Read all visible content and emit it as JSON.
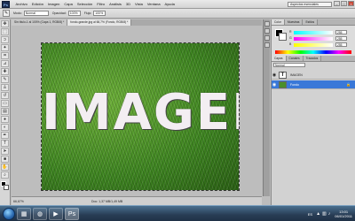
{
  "app": {
    "logo_text": "Ps"
  },
  "menu": [
    "Archivo",
    "Edición",
    "Imagen",
    "Capa",
    "Selección",
    "Filtro",
    "Análisis",
    "3D",
    "Vista",
    "Ventana",
    "Ayuda"
  ],
  "workspace": {
    "label": "Aspectos esenciales"
  },
  "options_bar": {
    "mode_label": "Modo:",
    "mode_value": "Normal",
    "opacity_label": "Opacidad:",
    "opacity_value": "100%",
    "flow_label": "Flujo:",
    "flow_value": "100%"
  },
  "tabs": [
    {
      "label": "Sin título-1 al 100% (Capa 1, RGB/8) *",
      "active": false
    },
    {
      "label": "fondo-grande.jpg al 66,7% (Fondo, RGB/8) *",
      "active": true
    }
  ],
  "canvas": {
    "text": "IMAGEN"
  },
  "status": {
    "zoom": "66,67%",
    "doc_info": "Doc: 1,37 MB/1,49 MB"
  },
  "color_panel": {
    "tabs": [
      "Color",
      "Muestras",
      "Estilos"
    ],
    "sliders": [
      {
        "label": "R",
        "value": "255"
      },
      {
        "label": "G",
        "value": "255"
      },
      {
        "label": "B",
        "value": "255"
      }
    ]
  },
  "layers_panel": {
    "tabs": [
      "Capas",
      "Canales",
      "Trazados"
    ],
    "blend_mode": "Normal",
    "layers": [
      {
        "name": "IMAGEN",
        "type": "text",
        "selected": false
      },
      {
        "name": "Fondo",
        "type": "image",
        "selected": true
      }
    ]
  },
  "taskbar": {
    "language": "ES",
    "time": "13:01",
    "date": "06/01/2011"
  }
}
